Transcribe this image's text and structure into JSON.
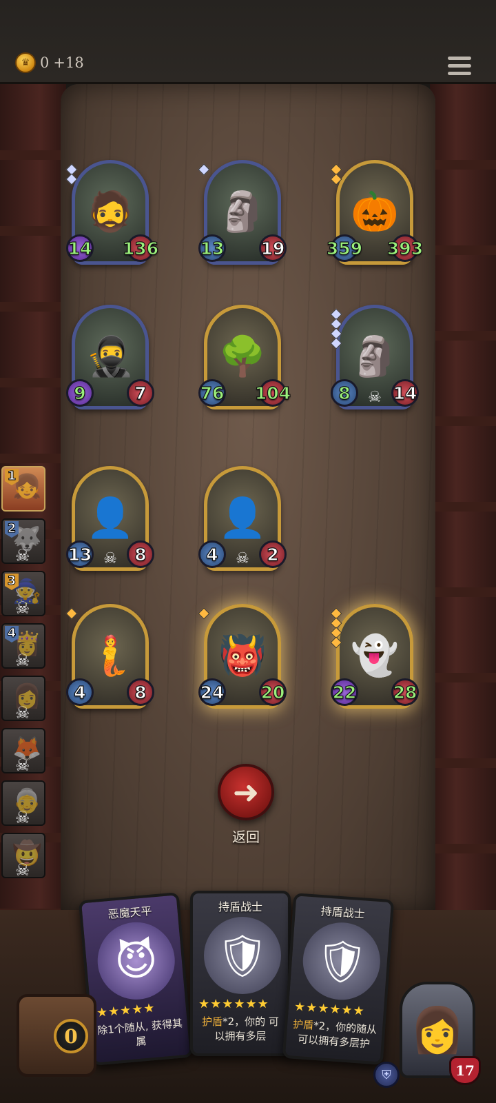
{
  "header": {
    "gold_amount": "0",
    "gold_income": "+18",
    "coin_icon": "crown-coin-icon",
    "menu_icon": "menu-icon"
  },
  "board": {
    "rows": [
      [
        {
          "name": "dwarf-warrior",
          "face": "🧔",
          "frame": "blue",
          "atk": "14",
          "atk_style": "purple",
          "hp": "136",
          "gems": 2,
          "gem": "silver"
        },
        {
          "name": "stone-golem",
          "face": "🗿",
          "frame": "blue",
          "atk": "13",
          "atk_style": "blue",
          "hp": "19",
          "gems": 1,
          "gem": "silver"
        },
        {
          "name": "pumpkin-mummy",
          "face": "🎃",
          "frame": "gold",
          "atk": "359",
          "atk_style": "blue",
          "hp": "393",
          "gems": 2,
          "gem": "gold"
        }
      ],
      [
        {
          "name": "hooded-assassin",
          "face": "🥷",
          "frame": "blue",
          "atk": "9",
          "atk_style": "purple",
          "hp": "7",
          "gems": 0
        },
        {
          "name": "treant",
          "face": "🌳",
          "frame": "gold",
          "atk": "76",
          "atk_style": "blue",
          "hp": "104",
          "gems": 0
        },
        {
          "name": "stone-golem",
          "face": "🗿",
          "frame": "blue",
          "atk": "8",
          "atk_style": "blue",
          "hp": "14",
          "gems": 4,
          "gem": "silver",
          "skull": true
        }
      ],
      [
        {
          "name": "shadow-reaper",
          "face": "👤",
          "frame": "gold",
          "atk": "13",
          "atk_style": "blue",
          "hp": "8",
          "gems": 0,
          "skull": true
        },
        {
          "name": "shadow-reaper",
          "face": "👤",
          "frame": "gold",
          "atk": "4",
          "atk_style": "blue",
          "hp": "2",
          "gems": 0,
          "skull": true
        }
      ],
      [
        {
          "name": "siren-maiden",
          "face": "🧜",
          "frame": "gold",
          "atk": "4",
          "atk_style": "blue",
          "hp": "8",
          "gems": 1,
          "gem": "gold"
        },
        {
          "name": "pumpkin-knight",
          "face": "👹",
          "frame": "gold",
          "atk": "24",
          "atk_style": "blue",
          "hp": "20",
          "gems": 1,
          "gem": "gold",
          "glow": true
        },
        {
          "name": "ghost-executioner",
          "face": "👻",
          "frame": "gold",
          "atk": "22",
          "atk_style": "purple",
          "hp": "28",
          "gems": 4,
          "gem": "gold",
          "glow": true
        }
      ]
    ]
  },
  "roster": [
    {
      "num": "1",
      "face": "👧",
      "style": "gold",
      "active": true
    },
    {
      "num": "2",
      "face": "🐺",
      "style": "blue"
    },
    {
      "num": "3",
      "face": "🧙",
      "style": "gold"
    },
    {
      "num": "4",
      "face": "👸",
      "style": "blue"
    },
    {
      "num": "",
      "face": "👩",
      "style": "none"
    },
    {
      "num": "",
      "face": "🦊",
      "style": "none"
    },
    {
      "num": "",
      "face": "👵",
      "style": "none"
    },
    {
      "num": "",
      "face": "🤠",
      "style": "none"
    }
  ],
  "back_button": {
    "label": "返回",
    "icon": "arrow-left-icon"
  },
  "hand": [
    {
      "title": "恶魔天平",
      "face": "😈",
      "stars": "★★★★★",
      "desc_kw": "",
      "desc": "除1个随从, 获得其属",
      "style": "demon"
    },
    {
      "title": "持盾战士",
      "face": "🛡",
      "stars": "★★★★★★",
      "desc_kw": "护盾",
      "desc": "*2，你的 可以拥有多层",
      "style": "normal"
    },
    {
      "title": "持盾战士",
      "face": "🛡",
      "stars": "★★★★★★",
      "desc_kw": "护盾",
      "desc": "*2，你的随从 可以拥有多层护",
      "style": "normal"
    }
  ],
  "hud": {
    "chest_count": "0",
    "hero_hp": "17",
    "hero_face": "👩",
    "shield_icon": "shield-icon"
  }
}
